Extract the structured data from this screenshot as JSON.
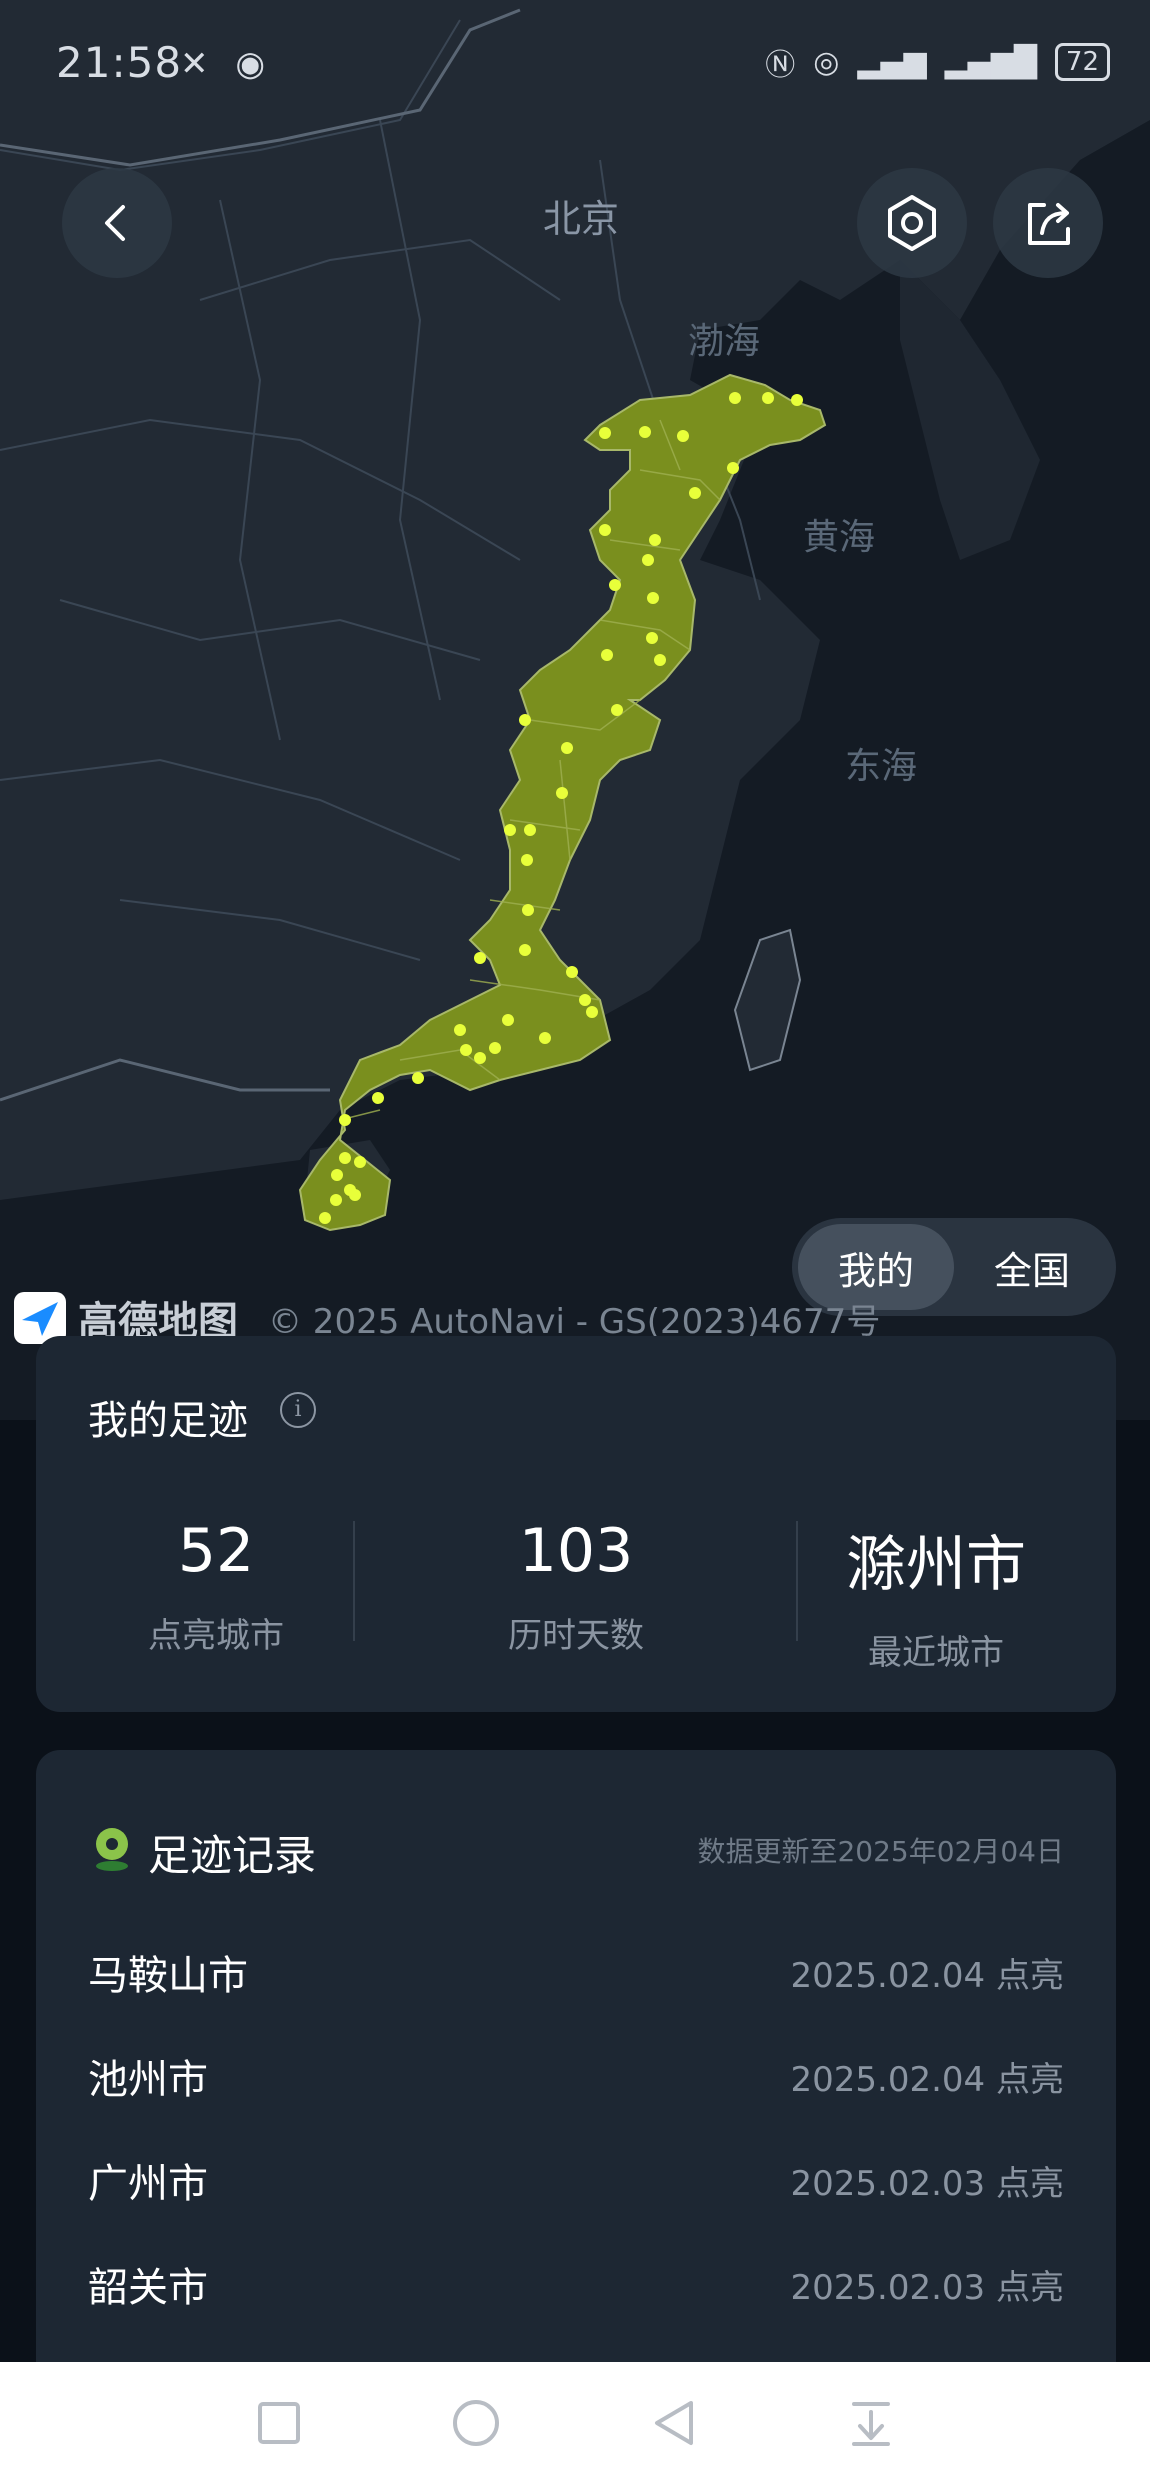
{
  "status_bar": {
    "time": "21:58",
    "battery": "72"
  },
  "map": {
    "labels": {
      "beijing": "北京",
      "bohai": "渤海",
      "huanghai": "黄海",
      "donghai": "东海"
    },
    "lit_color": "#7a8f1e",
    "dot_color": "#e8ff3a"
  },
  "toggle": {
    "mine": "我的",
    "national": "全国",
    "active": "mine"
  },
  "attribution": {
    "logo_text": "高德地图",
    "copyright": "© 2025 AutoNavi - GS(2023)4677号"
  },
  "footprint": {
    "title": "我的足迹",
    "stats": [
      {
        "value": "52",
        "label": "点亮城市"
      },
      {
        "value": "103",
        "label": "历时天数"
      },
      {
        "value": "滁州市",
        "label": "最近城市"
      }
    ]
  },
  "records": {
    "title": "足迹记录",
    "update_text": "数据更新至2025年02月04日",
    "items": [
      {
        "city": "马鞍山市",
        "date": "2025.02.04 点亮"
      },
      {
        "city": "池州市",
        "date": "2025.02.04 点亮"
      },
      {
        "city": "广州市",
        "date": "2025.02.03 点亮"
      },
      {
        "city": "韶关市",
        "date": "2025.02.03 点亮"
      }
    ]
  },
  "icons": {
    "back": "chevron-left-icon",
    "settings": "hexagon-settings-icon",
    "share": "share-icon",
    "info": "info-icon",
    "location": "location-pin-icon"
  }
}
